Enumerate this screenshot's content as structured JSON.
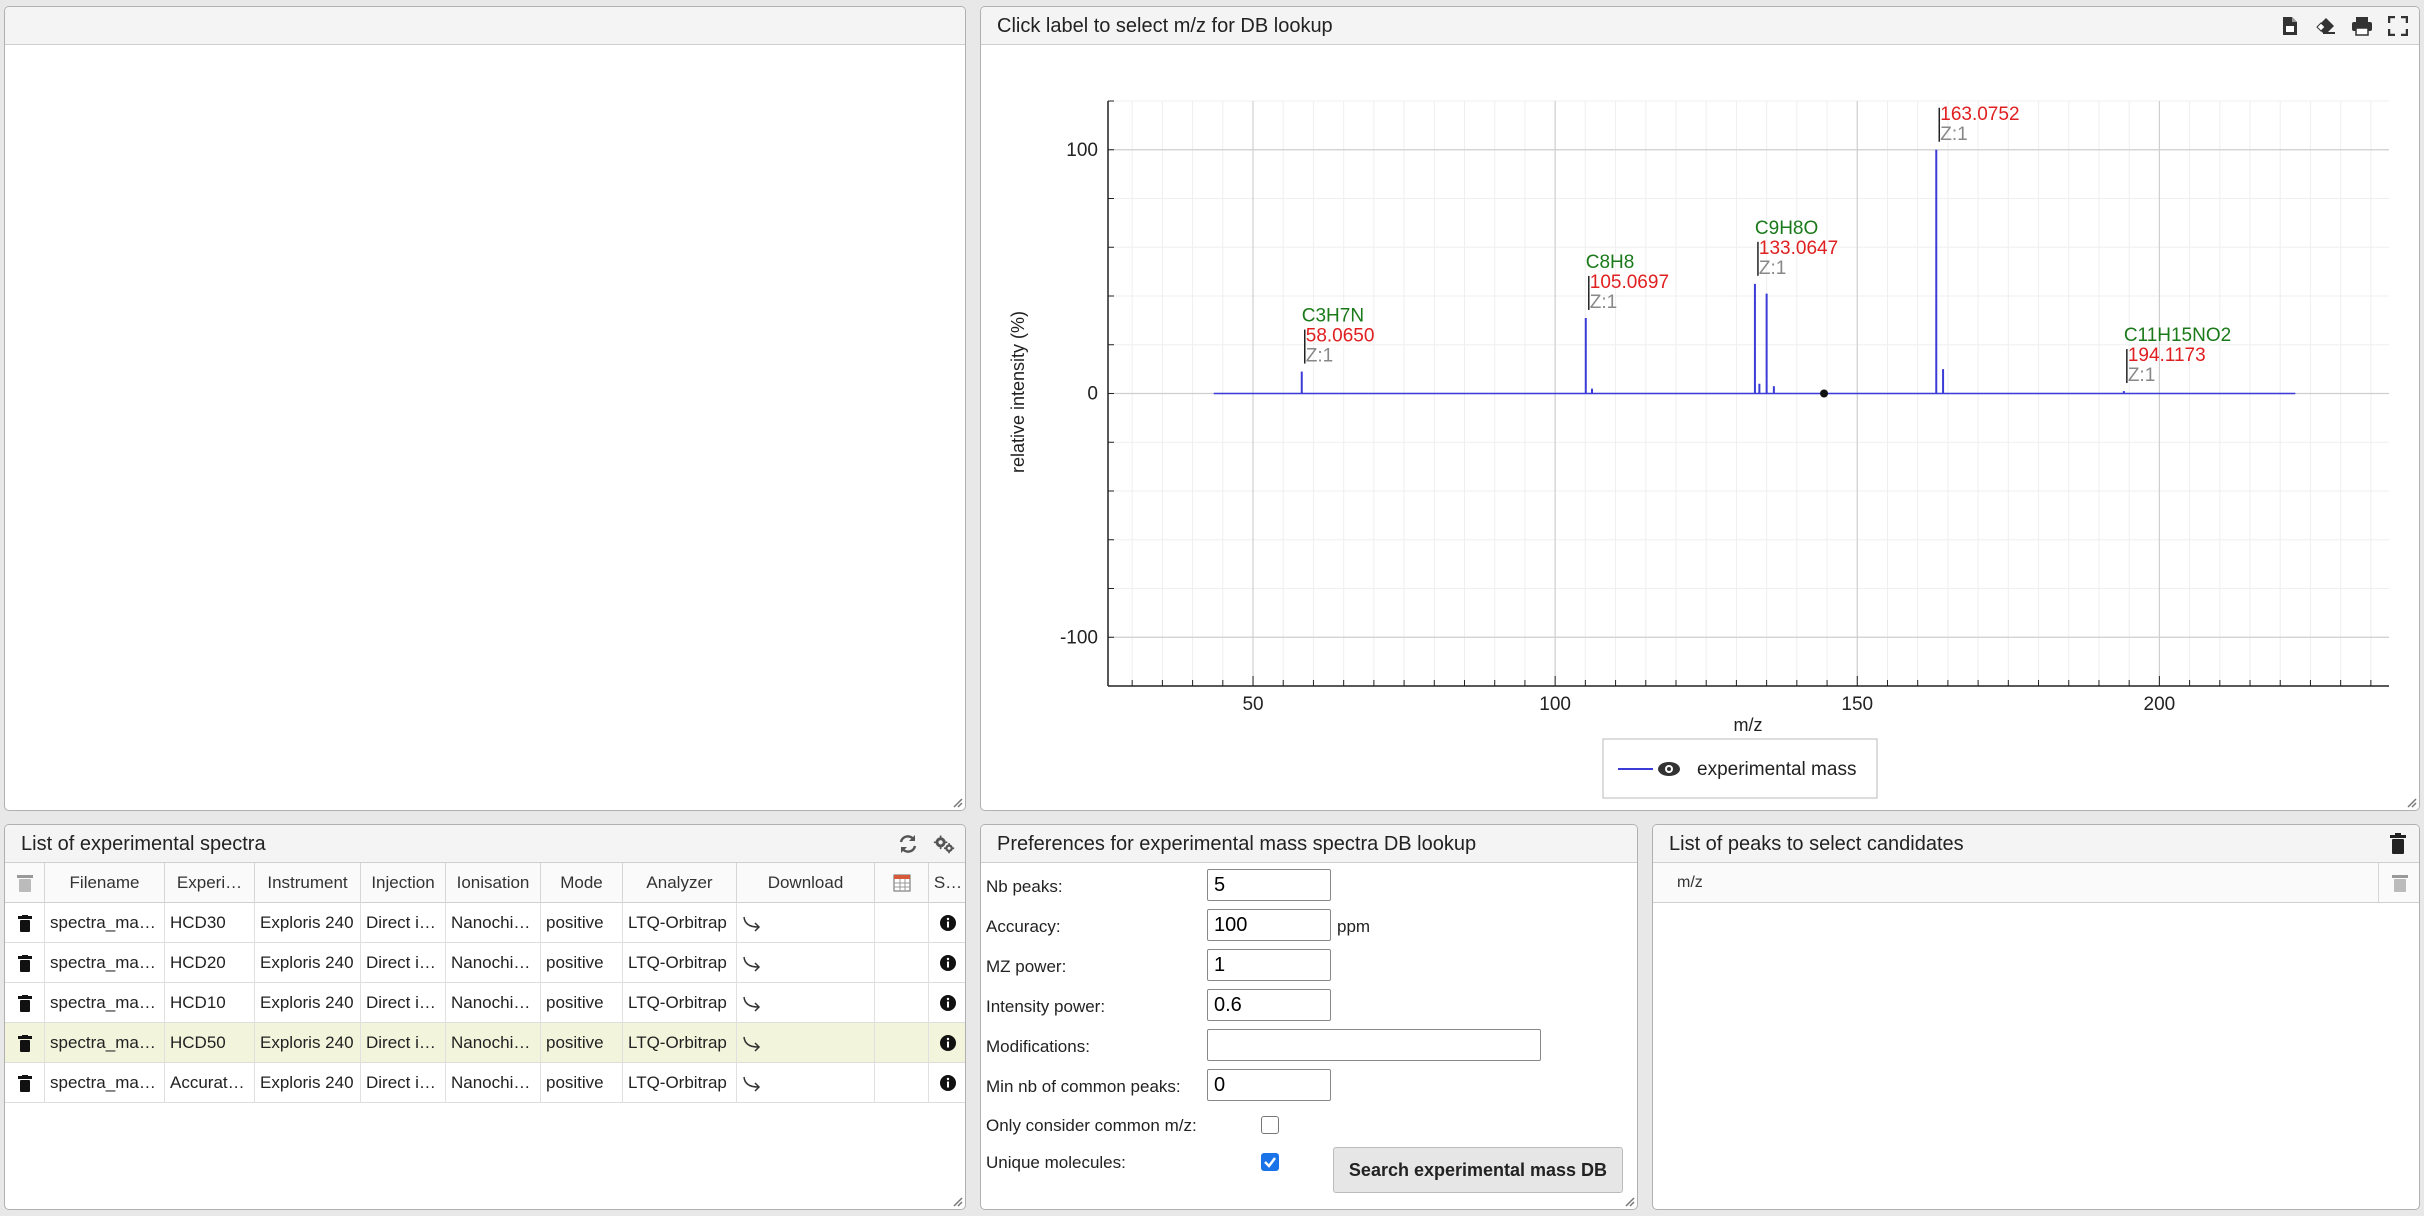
{
  "spectrum_panel": {
    "title": "Click label to select m/z for DB lookup",
    "legend_label": "experimental mass",
    "icons": [
      "export-icon",
      "eraser-icon",
      "print-icon",
      "fullscreen-icon"
    ]
  },
  "chart_data": {
    "type": "bar",
    "xlabel": "m/z",
    "ylabel": "relative intensity (%)",
    "xlim": [
      26,
      238
    ],
    "ylim": [
      -120,
      120
    ],
    "x_ticks": [
      50,
      100,
      150,
      200
    ],
    "y_ticks": [
      -100,
      0,
      100
    ],
    "grid": true,
    "legend": "bottom-center",
    "baseline": [
      43.5,
      222.5
    ],
    "series": [
      {
        "name": "experimental mass",
        "color": "#3b3bd8",
        "peaks": [
          {
            "mz": 58.065,
            "intensity": 9
          },
          {
            "mz": 105.0697,
            "intensity": 31
          },
          {
            "mz": 106.1,
            "intensity": 2
          },
          {
            "mz": 133.0647,
            "intensity": 45
          },
          {
            "mz": 133.8,
            "intensity": 4
          },
          {
            "mz": 135.0,
            "intensity": 41
          },
          {
            "mz": 136.2,
            "intensity": 3
          },
          {
            "mz": 163.0752,
            "intensity": 100
          },
          {
            "mz": 164.2,
            "intensity": 10
          },
          {
            "mz": 194.1173,
            "intensity": 1
          }
        ]
      }
    ],
    "annotations": [
      {
        "mz": 58.065,
        "intensity": 9,
        "formula": "C3H7N",
        "mass": "58.0650",
        "charge": "Z:1"
      },
      {
        "mz": 105.0697,
        "intensity": 31,
        "formula": "C8H8",
        "mass": "105.0697",
        "charge": "Z:1"
      },
      {
        "mz": 133.0647,
        "intensity": 45,
        "formula": "C9H8O",
        "mass": "133.0647",
        "charge": "Z:1"
      },
      {
        "mz": 163.0752,
        "intensity": 100,
        "formula": "",
        "mass": "163.0752",
        "charge": "Z:1"
      },
      {
        "mz": 194.1173,
        "intensity": 1,
        "formula": "C11H15NO2",
        "mass": "194.1173",
        "charge": "Z:1"
      }
    ],
    "marker_point": {
      "mz": 144.5,
      "intensity": 0
    }
  },
  "spectra_list": {
    "title": "List of experimental spectra",
    "columns": [
      "",
      "Filename",
      "Experi…",
      "Instrument",
      "Injection",
      "Ionisation",
      "Mode",
      "Analyzer",
      "Download",
      "",
      "S…"
    ],
    "rows": [
      [
        "spectra_ma…",
        "HCD30",
        "Exploris 240",
        "Direct i…",
        "Nanochi…",
        "positive",
        "LTQ-Orbitrap"
      ],
      [
        "spectra_ma…",
        "HCD20",
        "Exploris 240",
        "Direct i…",
        "Nanochi…",
        "positive",
        "LTQ-Orbitrap"
      ],
      [
        "spectra_ma…",
        "HCD10",
        "Exploris 240",
        "Direct i…",
        "Nanochi…",
        "positive",
        "LTQ-Orbitrap"
      ],
      [
        "spectra_ma…",
        "HCD50",
        "Exploris 240",
        "Direct i…",
        "Nanochi…",
        "positive",
        "LTQ-Orbitrap"
      ],
      [
        "spectra_ma…",
        "Accurat…",
        "Exploris 240",
        "Direct i…",
        "Nanochi…",
        "positive",
        "LTQ-Orbitrap"
      ]
    ],
    "highlighted_row": 3
  },
  "prefs": {
    "title": "Preferences for experimental mass spectra DB lookup",
    "nb_peaks_label": "Nb peaks:",
    "nb_peaks": "5",
    "accuracy_label": "Accuracy:",
    "accuracy": "100",
    "accuracy_unit": "ppm",
    "mz_power_label": "MZ power:",
    "mz_power": "1",
    "intensity_power_label": "Intensity power:",
    "intensity_power": "0.6",
    "modifications_label": "Modifications:",
    "modifications": "",
    "min_common_label": "Min nb of common peaks:",
    "min_common": "0",
    "only_common_label": "Only consider common m/z:",
    "only_common": false,
    "unique_label": "Unique molecules:",
    "unique": true,
    "search_button": "Search experimental mass DB"
  },
  "peaks_panel": {
    "title": "List of peaks to select candidates",
    "column": "m/z"
  }
}
